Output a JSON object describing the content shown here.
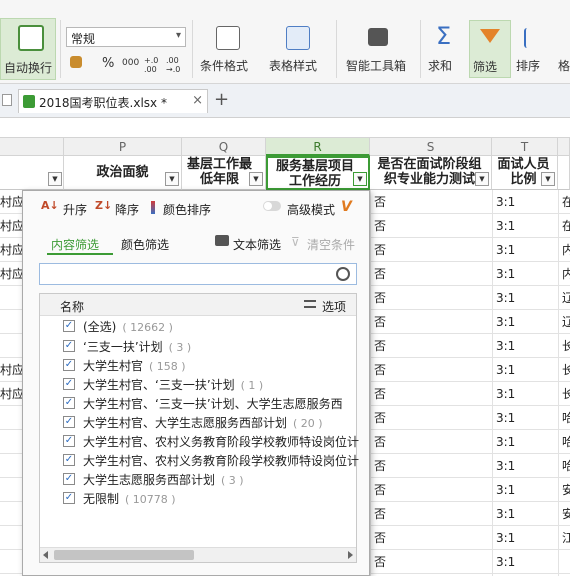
{
  "ribbon": {
    "auto_wrap_label": "自动换行",
    "number_format_value": "常规",
    "percent_symbol": "%",
    "thousands_symbol": "000",
    "inc_decimal_symbol": "+.0 .00",
    "dec_decimal_symbol": ".00 →.0",
    "conditional_format_label": "条件格式",
    "table_style_label": "表格样式",
    "smart_toolbox_label": "智能工具箱",
    "sum_label": "求和",
    "filter_label": "筛选",
    "sort_label": "排序",
    "more_label": "格",
    "dropdown_arrow": "▾",
    "accent_color": "#3c9b35"
  },
  "tabs": {
    "file_tab_label": "2018国考职位表.xlsx *",
    "close_symbol": "×",
    "add_symbol": "+"
  },
  "columns": [
    {
      "letter": "P",
      "header": "政治面貌"
    },
    {
      "letter": "Q",
      "header": "基层工作最低年限"
    },
    {
      "letter": "R",
      "header": "服务基层项目工作经历"
    },
    {
      "letter": "S",
      "header": "是否在面试阶段组织专业能力测试"
    },
    {
      "letter": "T",
      "header": "面试人员比例"
    }
  ],
  "rows_s": [
    "否",
    "否",
    "否",
    "否",
    "否",
    "否",
    "否",
    "否",
    "否",
    "否",
    "否",
    "否",
    "否",
    "否",
    "否",
    "否"
  ],
  "rows_t": [
    "3:1",
    "3:1",
    "3:1",
    "3:1",
    "3:1",
    "3:1",
    "3:1",
    "3:1",
    "3:1",
    "3:1",
    "3:1",
    "3:1",
    "3:1",
    "3:1",
    "3:1",
    "3:1"
  ],
  "rows_u": [
    "在",
    "在",
    "内",
    "内",
    "辽",
    "辽",
    "长",
    "长",
    "长",
    "哈",
    "哈",
    "哈",
    "安",
    "安",
    "江",
    ""
  ],
  "rows_left": [
    "村应",
    "村应",
    "村应",
    "村应",
    "",
    "",
    "",
    "村应",
    "村应",
    "",
    "",
    "",
    "",
    "",
    "",
    ""
  ],
  "filter_panel": {
    "sort_asc_label": "升序",
    "sort_desc_label": "降序",
    "color_sort_label": "颜色排序",
    "advanced_mode_label": "高级模式",
    "vip_badge": "V",
    "tab_content": "内容筛选",
    "tab_color": "颜色筛选",
    "text_filter_label": "文本筛选",
    "clear_label": "清空条件",
    "search_value": "",
    "list_header_name": "名称",
    "list_header_options": "选项",
    "items": [
      {
        "label": "(全选)",
        "count": "( 12662 )"
      },
      {
        "label": "‘三支一扶’计划",
        "count": "( 3 )"
      },
      {
        "label": "大学生村官",
        "count": "( 158 )"
      },
      {
        "label": "大学生村官、‘三支一扶’计划",
        "count": "( 1 )"
      },
      {
        "label": "大学生村官、‘三支一扶’计划、大学生志愿服务西",
        "count": ""
      },
      {
        "label": "大学生村官、大学生志愿服务西部计划",
        "count": "( 20 )"
      },
      {
        "label": "大学生村官、农村义务教育阶段学校教师特设岗位计",
        "count": ""
      },
      {
        "label": "大学生村官、农村义务教育阶段学校教师特设岗位计",
        "count": ""
      },
      {
        "label": "大学生志愿服务西部计划",
        "count": "( 3 )"
      },
      {
        "label": "无限制",
        "count": "( 10778 )"
      }
    ],
    "check_mark": "✓"
  }
}
